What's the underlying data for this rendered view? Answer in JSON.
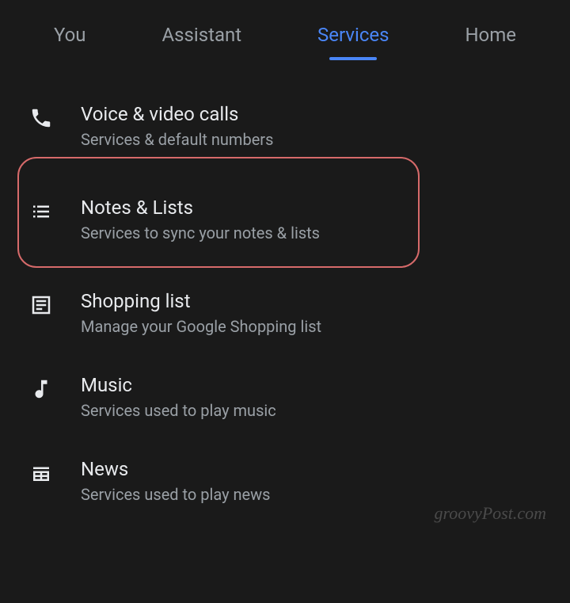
{
  "tabs": [
    {
      "label": "You",
      "active": false
    },
    {
      "label": "Assistant",
      "active": false
    },
    {
      "label": "Services",
      "active": true
    },
    {
      "label": "Home",
      "active": false
    }
  ],
  "items": [
    {
      "icon": "phone-icon",
      "title": "Voice & video calls",
      "subtitle": "Services & default numbers",
      "highlighted": false
    },
    {
      "icon": "list-icon",
      "title": "Notes & Lists",
      "subtitle": "Services to sync your notes & lists",
      "highlighted": true
    },
    {
      "icon": "document-icon",
      "title": "Shopping list",
      "subtitle": "Manage your Google Shopping list",
      "highlighted": false
    },
    {
      "icon": "music-note-icon",
      "title": "Music",
      "subtitle": "Services used to play music",
      "highlighted": false
    },
    {
      "icon": "news-icon",
      "title": "News",
      "subtitle": "Services used to play news",
      "highlighted": false
    }
  ],
  "watermark": "groovyPost.com"
}
